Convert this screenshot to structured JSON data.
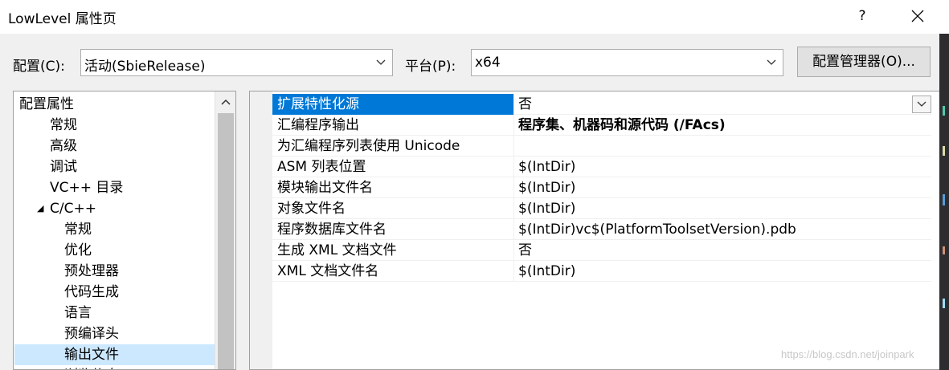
{
  "window": {
    "title": "LowLevel 属性页",
    "help_label": "?",
    "close_icon": "close-icon"
  },
  "config_row": {
    "config_label": "配置(C):",
    "config_value": "活动(SbieRelease)",
    "platform_label": "平台(P):",
    "platform_value": "x64",
    "manager_button": "配置管理器(O)..."
  },
  "tree": {
    "items": [
      {
        "label": "配置属性",
        "level": 0,
        "expanded": true
      },
      {
        "label": "常规",
        "level": 1
      },
      {
        "label": "高级",
        "level": 1
      },
      {
        "label": "调试",
        "level": 1
      },
      {
        "label": "VC++ 目录",
        "level": 1
      },
      {
        "label": "C/C++",
        "level": 1,
        "expanded": true
      },
      {
        "label": "常规",
        "level": 2
      },
      {
        "label": "优化",
        "level": 2
      },
      {
        "label": "预处理器",
        "level": 2
      },
      {
        "label": "代码生成",
        "level": 2
      },
      {
        "label": "语言",
        "level": 2
      },
      {
        "label": "预编译头",
        "level": 2
      },
      {
        "label": "输出文件",
        "level": 2,
        "selected": true
      },
      {
        "label": "浏览信息",
        "level": 2
      }
    ]
  },
  "properties": {
    "rows": [
      {
        "name": "扩展特性化源",
        "value": "否",
        "selected": true,
        "bold": false
      },
      {
        "name": "汇编程序输出",
        "value": "程序集、机器码和源代码 (/FAcs)",
        "bold": true
      },
      {
        "name": "为汇编程序列表使用 Unicode",
        "value": "",
        "bold": false
      },
      {
        "name": "ASM 列表位置",
        "value": "$(IntDir)",
        "bold": false
      },
      {
        "name": "模块输出文件名",
        "value": "$(IntDir)",
        "bold": false
      },
      {
        "name": "对象文件名",
        "value": "$(IntDir)",
        "bold": false
      },
      {
        "name": "程序数据库文件名",
        "value": "$(IntDir)vc$(PlatformToolsetVersion).pdb",
        "bold": false
      },
      {
        "name": "生成 XML 文档文件",
        "value": "否",
        "bold": false
      },
      {
        "name": "XML 文档文件名",
        "value": "$(IntDir)",
        "bold": false
      }
    ]
  },
  "watermark": "https://blog.csdn.net/joinpark",
  "colors": {
    "selection": "#0078d7",
    "tree_selection": "#cce8ff",
    "dark_strip": "#2d2d30"
  }
}
